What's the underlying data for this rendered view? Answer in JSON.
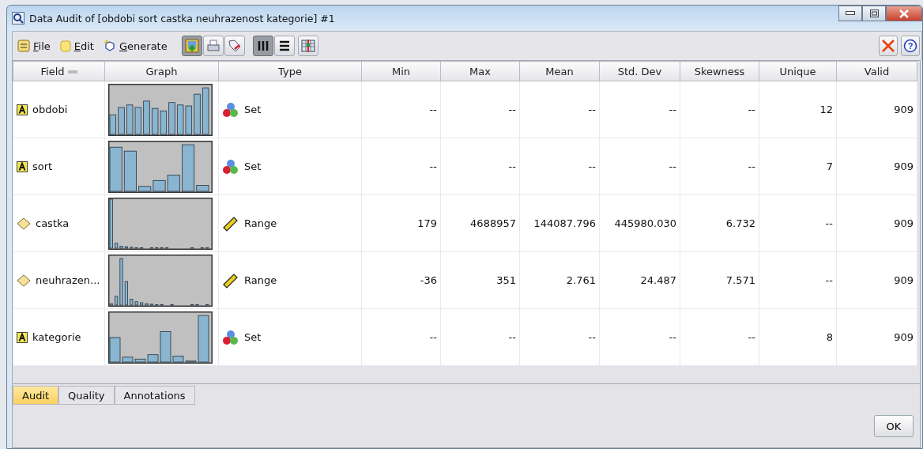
{
  "window": {
    "title": "Data Audit of [obdobi sort castka neuhrazenost kategorie] #1"
  },
  "menu": [
    {
      "label": "File"
    },
    {
      "label": "Edit"
    },
    {
      "label": "Generate"
    }
  ],
  "help_label": "?",
  "view_buttons": [
    {
      "selected": true
    },
    {
      "selected": false
    }
  ],
  "table": {
    "columns": [
      "Field",
      "Graph",
      "Type",
      "Min",
      "Max",
      "Mean",
      "Std. Dev",
      "Skewness",
      "Unique",
      "Valid"
    ],
    "rows": [
      {
        "kind": "set",
        "field": "obdobi",
        "type": "Set",
        "min": "--",
        "max": "--",
        "mean": "--",
        "std_dev": "--",
        "skewness": "--",
        "unique": "12",
        "valid": "909"
      },
      {
        "kind": "set",
        "field": "sort",
        "type": "Set",
        "min": "--",
        "max": "--",
        "mean": "--",
        "std_dev": "--",
        "skewness": "--",
        "unique": "7",
        "valid": "909"
      },
      {
        "kind": "range",
        "field": "castka",
        "type": "Range",
        "min": "179",
        "max": "4688957",
        "mean": "144087.796",
        "std_dev": "445980.030",
        "skewness": "6.732",
        "unique": "--",
        "valid": "909"
      },
      {
        "kind": "range",
        "field": "neuhrazen...",
        "type": "Range",
        "min": "-36",
        "max": "351",
        "mean": "2.761",
        "std_dev": "24.487",
        "skewness": "7.571",
        "unique": "--",
        "valid": "909"
      },
      {
        "kind": "set",
        "field": "kategorie",
        "type": "Set",
        "min": "--",
        "max": "--",
        "mean": "--",
        "std_dev": "--",
        "skewness": "--",
        "unique": "8",
        "valid": "909"
      }
    ]
  },
  "tabs": [
    {
      "label": "Audit",
      "selected": true
    },
    {
      "label": "Quality",
      "selected": false
    },
    {
      "label": "Annotations",
      "selected": false
    }
  ],
  "buttons": [
    "OK"
  ]
}
